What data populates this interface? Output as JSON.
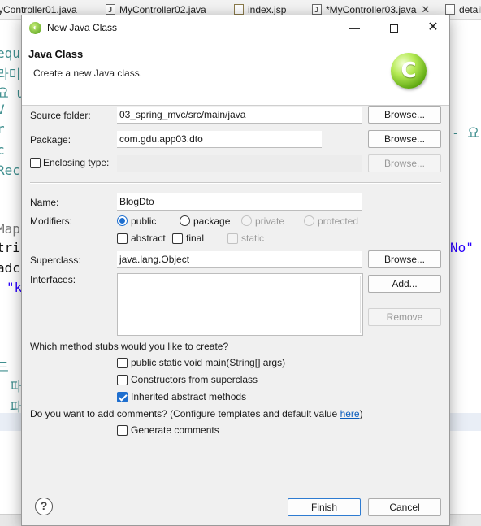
{
  "editor": {
    "tabs": [
      {
        "label": "yController01.java"
      },
      {
        "label": "MyController02.java"
      },
      {
        "label": "index.jsp"
      },
      {
        "label": "*MyController03.java"
      },
      {
        "label": "detail"
      }
    ],
    "code_lines": [
      "equ",
      "라미",
      "요 u",
      "V",
      "r",
      "c",
      "Rec",
      "Map",
      "tri",
      "adc",
      "\"k",
      "드",
      "파",
      "파"
    ],
    "code_right_1": "- 요",
    "code_right_2": "No\""
  },
  "dialog": {
    "title": "New Java Class",
    "window_controls": {
      "minimize": "—",
      "close": "✕"
    },
    "banner": {
      "heading": "Java Class",
      "description": "Create a new Java class.",
      "icon_letter": "C"
    },
    "source_folder": {
      "label": "Source folder:",
      "value": "03_spring_mvc/src/main/java",
      "button": "Browse..."
    },
    "package": {
      "label": "Package:",
      "value": "com.gdu.app03.dto",
      "button": "Browse..."
    },
    "enclosing_type": {
      "label": "Enclosing type:",
      "value": "",
      "button": "Browse...",
      "checked": false
    },
    "name": {
      "label": "Name:",
      "value": "BlogDto"
    },
    "modifiers": {
      "label": "Modifiers:",
      "access": [
        {
          "label": "public",
          "checked": true,
          "enabled": true
        },
        {
          "label": "package",
          "checked": false,
          "enabled": true
        },
        {
          "label": "private",
          "checked": false,
          "enabled": false
        },
        {
          "label": "protected",
          "checked": false,
          "enabled": false
        }
      ],
      "other": [
        {
          "label": "abstract",
          "checked": false,
          "enabled": true
        },
        {
          "label": "final",
          "checked": false,
          "enabled": true
        },
        {
          "label": "static",
          "checked": false,
          "enabled": false
        }
      ]
    },
    "superclass": {
      "label": "Superclass:",
      "value": "java.lang.Object",
      "button": "Browse..."
    },
    "interfaces": {
      "label": "Interfaces:",
      "add_button": "Add...",
      "remove_button": "Remove"
    },
    "stubs": {
      "question": "Which method stubs would you like to create?",
      "options": [
        {
          "label": "public static void main(String[] args)",
          "checked": false
        },
        {
          "label": "Constructors from superclass",
          "checked": false
        },
        {
          "label": "Inherited abstract methods",
          "checked": true
        }
      ]
    },
    "comments": {
      "question_prefix": "Do you want to add comments? (Configure templates and default value ",
      "link": "here",
      "question_suffix": ")",
      "option": {
        "label": "Generate comments",
        "checked": false
      }
    },
    "footer": {
      "help_icon": "?",
      "finish": "Finish",
      "cancel": "Cancel"
    }
  },
  "colors": {
    "accent": "#1f6fcf",
    "link": "#0b5dbd",
    "icon_green": "#5ea811"
  }
}
